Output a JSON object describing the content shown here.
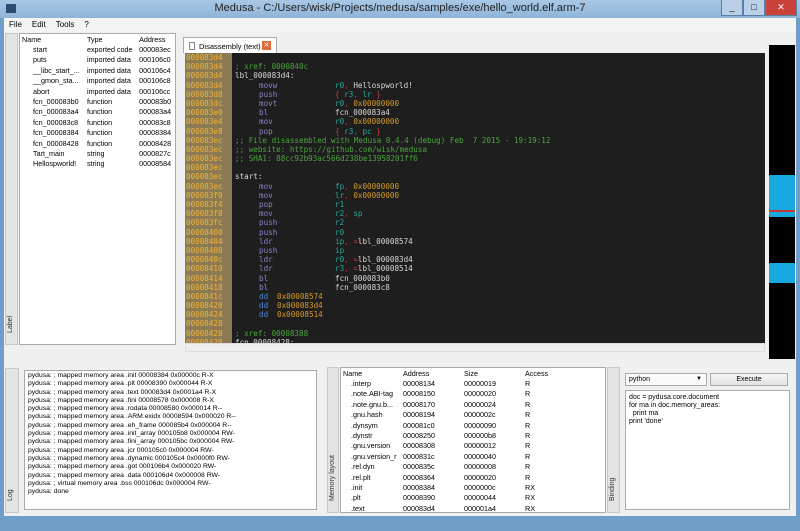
{
  "window": {
    "title": "Medusa - C:/Users/wisk/Projects/medusa/samples/exe/hello_world.elf.arm-7",
    "minimize": "_",
    "maximize": "□",
    "close": "✕"
  },
  "menu": [
    "File",
    "Edit",
    "Tools",
    "?"
  ],
  "labels": {
    "dock_title": "Label",
    "columns": [
      "Name",
      "Type",
      "Address"
    ],
    "rows": [
      [
        "start",
        "exported code",
        "000083ec"
      ],
      [
        "puts",
        "imported data",
        "000106c0"
      ],
      [
        "__libc_start_...",
        "imported data",
        "000106c4"
      ],
      [
        "__gmon_sta...",
        "imported data",
        "000106c8"
      ],
      [
        "abort",
        "imported data",
        "000106cc"
      ],
      [
        "fcn_000083b0",
        "function",
        "000083b0"
      ],
      [
        "fcn_000083a4",
        "function",
        "000083a4"
      ],
      [
        "fcn_000083c8",
        "function",
        "000083c8"
      ],
      [
        "fcn_00008384",
        "function",
        "00008384"
      ],
      [
        "fcn_00008428",
        "function",
        "00008428"
      ],
      [
        "Tart_main",
        "string",
        "0000827c"
      ],
      [
        "Hellospworld!",
        "string",
        "00008584"
      ]
    ]
  },
  "tab": {
    "label": "Disassembly (text)",
    "close": "✕"
  },
  "disasm": [
    {
      "a": "000083d4"
    },
    {
      "a": "000083d4",
      "t": "; xref: 0000840c",
      "c": "com"
    },
    {
      "a": "000083d4",
      "t": "lbl_000083d4:",
      "c": "lbl"
    },
    {
      "a": "000083d4",
      "m": "movw",
      "o": [
        [
          "r0",
          "reg"
        ],
        [
          ", ",
          "pun"
        ],
        [
          "Hellospworld!",
          "sym"
        ]
      ]
    },
    {
      "a": "000083d8",
      "m": "push",
      "o": [
        [
          "{ ",
          "br"
        ],
        [
          "r3",
          "reg"
        ],
        [
          ", ",
          "pun"
        ],
        [
          "lr",
          "reg"
        ],
        [
          " }",
          "br"
        ]
      ]
    },
    {
      "a": "000083dc",
      "m": "movt",
      "o": [
        [
          "r0",
          "reg"
        ],
        [
          ", ",
          "pun"
        ],
        [
          "0x00000000",
          "num"
        ]
      ]
    },
    {
      "a": "000083e0",
      "m": "bl",
      "o": [
        [
          "fcn_000083a4",
          "sym"
        ]
      ]
    },
    {
      "a": "000083e4",
      "m": "mov",
      "o": [
        [
          "r0",
          "reg"
        ],
        [
          ", ",
          "pun"
        ],
        [
          "0x00000000",
          "num"
        ]
      ]
    },
    {
      "a": "000083e8",
      "m": "pop",
      "o": [
        [
          "{ ",
          "br"
        ],
        [
          "r3",
          "reg"
        ],
        [
          ", ",
          "pun"
        ],
        [
          "pc",
          "reg"
        ],
        [
          " }",
          "br"
        ]
      ]
    },
    {
      "a": "000083ec",
      "t": ";; File disassembled with Medusa 0.4.4 (debug) Feb  7 2015 - 19:19:12",
      "c": "com"
    },
    {
      "a": "000083ec",
      "t": ";; website: https://github.com/wisk/medusa",
      "c": "com"
    },
    {
      "a": "000083ec",
      "t": ";; SHA1: 88cc92b93ac566d238be13958201ff6",
      "c": "com"
    },
    {
      "a": "000083ec"
    },
    {
      "a": "000083ec",
      "t": "start:",
      "c": "lbl"
    },
    {
      "a": "000083ec",
      "m": "mov",
      "o": [
        [
          "fp",
          "reg"
        ],
        [
          ", ",
          "pun"
        ],
        [
          "0x00000000",
          "num"
        ]
      ]
    },
    {
      "a": "000083f0",
      "m": "mov",
      "o": [
        [
          "lr",
          "reg"
        ],
        [
          ", ",
          "pun"
        ],
        [
          "0x00000000",
          "num"
        ]
      ]
    },
    {
      "a": "000083f4",
      "m": "pop",
      "o": [
        [
          "r1",
          "reg"
        ]
      ]
    },
    {
      "a": "000083f8",
      "m": "mov",
      "o": [
        [
          "r2",
          "reg"
        ],
        [
          ", ",
          "pun"
        ],
        [
          "sp",
          "reg"
        ]
      ]
    },
    {
      "a": "000083fc",
      "m": "push",
      "o": [
        [
          "r2",
          "reg"
        ]
      ]
    },
    {
      "a": "00008400",
      "m": "push",
      "o": [
        [
          "r0",
          "reg"
        ]
      ]
    },
    {
      "a": "00008404",
      "m": "ldr",
      "o": [
        [
          "ip",
          "reg"
        ],
        [
          ", =",
          "pun"
        ],
        [
          "lbl_00008574",
          "sym"
        ]
      ]
    },
    {
      "a": "00008408",
      "m": "push",
      "o": [
        [
          "ip",
          "reg"
        ]
      ]
    },
    {
      "a": "0000840c",
      "m": "ldr",
      "o": [
        [
          "r0",
          "reg"
        ],
        [
          ", =",
          "pun"
        ],
        [
          "lbl_000083d4",
          "sym"
        ]
      ]
    },
    {
      "a": "00008410",
      "m": "ldr",
      "o": [
        [
          "r3",
          "reg"
        ],
        [
          ", =",
          "pun"
        ],
        [
          "lbl_00008514",
          "sym"
        ]
      ]
    },
    {
      "a": "00008414",
      "m": "bl",
      "o": [
        [
          "fcn_000083b0",
          "sym"
        ]
      ]
    },
    {
      "a": "00008418",
      "m": "bl",
      "o": [
        [
          "fcn_000083c8",
          "sym"
        ]
      ]
    },
    {
      "a": "0000841c",
      "d": "dd",
      "o": [
        [
          "0x00008574",
          "num"
        ]
      ]
    },
    {
      "a": "00008420",
      "d": "dd",
      "o": [
        [
          "0x000083d4",
          "num"
        ]
      ]
    },
    {
      "a": "00008424",
      "d": "dd",
      "o": [
        [
          "0x00008514",
          "num"
        ]
      ]
    },
    {
      "a": "00008428"
    },
    {
      "a": "00008428",
      "t": "; xref: 00008388",
      "c": "com"
    },
    {
      "a": "00008428",
      "t": "fcn_00008428:",
      "c": "lbl"
    }
  ],
  "log": {
    "dock_title": "Log",
    "lines": [
      "pydusa: ; mapped memory area .init 00008384 0x00000c R-X",
      "pydusa: ; mapped memory area .plt 00008390 0x000044 R-X",
      "pydusa: ; mapped memory area .text 000083d4 0x0001a4 R-X",
      "pydusa: ; mapped memory area .fini 00008578 0x000008 R-X",
      "pydusa: ; mapped memory area .rodata 00008580 0x000014 R--",
      "pydusa: ; mapped memory area .ARM.exidx 00008594 0x000020 R--",
      "pydusa: ; mapped memory area .eh_frame 000085b4 0x000004 R--",
      "pydusa: ; mapped memory area .init_array 000105b8 0x000004 RW-",
      "pydusa: ; mapped memory area .fini_array 000105bc 0x000004 RW-",
      "pydusa: ; mapped memory area .jcr 000105c0 0x000004 RW-",
      "pydusa: ; mapped memory area .dynamic 000105c4 0x0000f0 RW-",
      "pydusa: ; mapped memory area .got 000106b4 0x000020 RW-",
      "pydusa: ; mapped memory area .data 000106d4 0x000008 RW-",
      "pydusa: ; virtual memory area .bss 000106dc 0x000004 RW-",
      "pydusa: done"
    ]
  },
  "memory": {
    "dock_title": "Memory layout",
    "columns": [
      "Name",
      "Address",
      "Size",
      "Access"
    ],
    "rows": [
      [
        ".interp",
        "00008134",
        "00000019",
        "R"
      ],
      [
        ".note.ABI-tag",
        "00008150",
        "00000020",
        "R"
      ],
      [
        ".note.gnu.b...",
        "00008170",
        "00000024",
        "R"
      ],
      [
        ".gnu.hash",
        "00008194",
        "0000002c",
        "R"
      ],
      [
        ".dynsym",
        "000081c0",
        "00000090",
        "R"
      ],
      [
        ".dynstr",
        "00008250",
        "000000b8",
        "R"
      ],
      [
        ".gnu.version",
        "00008308",
        "00000012",
        "R"
      ],
      [
        ".gnu.version_r",
        "0000831c",
        "00000040",
        "R"
      ],
      [
        ".rel.dyn",
        "0000835c",
        "00000008",
        "R"
      ],
      [
        ".rel.plt",
        "00008364",
        "00000020",
        "R"
      ],
      [
        ".init",
        "00008384",
        "0000000c",
        "RX"
      ],
      [
        ".plt",
        "00008390",
        "00000044",
        "RX"
      ],
      [
        ".text",
        "000083d4",
        "000001a4",
        "RX"
      ]
    ]
  },
  "binding": {
    "dock_title": "Binding",
    "language": "python",
    "execute": "Execute",
    "script": "doc = pydusa.core.document\nfor ma in doc.memory_areas:\n  print ma\nprint 'done'"
  },
  "colors": {
    "code_bg": "#1e1e1e",
    "address": "#f0b43c",
    "comment": "#4aa43c",
    "register": "#28a89a",
    "number": "#d89a28",
    "mnemonic": "#8c82c8"
  }
}
